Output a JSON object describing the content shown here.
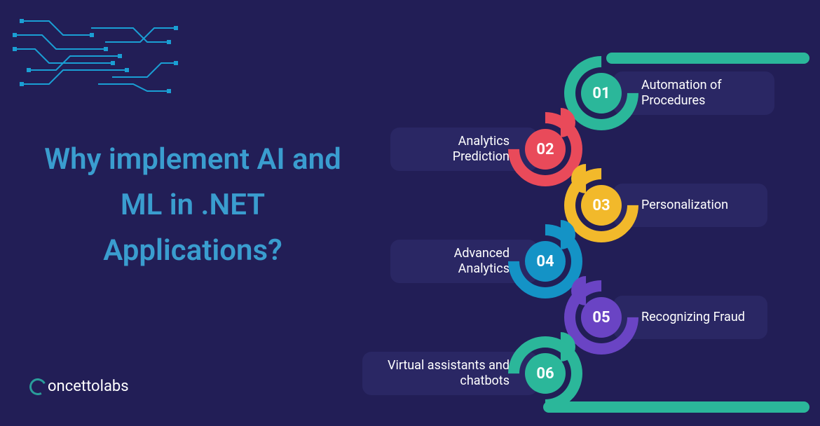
{
  "title": "Why implement AI and ML in .NET Applications?",
  "logo_text": "oncettolabs",
  "items": [
    {
      "num": "01",
      "label": "Automation of Procedures",
      "color": "#2bb79a"
    },
    {
      "num": "02",
      "label": "Analytics Prediction",
      "color": "#e94a5a"
    },
    {
      "num": "03",
      "label": "Personalization",
      "color": "#f2b92b"
    },
    {
      "num": "04",
      "label": "Advanced Analytics",
      "color": "#1493c6"
    },
    {
      "num": "05",
      "label": "Recognizing Fraud",
      "color": "#6a44c4"
    },
    {
      "num": "06",
      "label": "Virtual assistants and chatbots",
      "color": "#2bb79a"
    }
  ]
}
